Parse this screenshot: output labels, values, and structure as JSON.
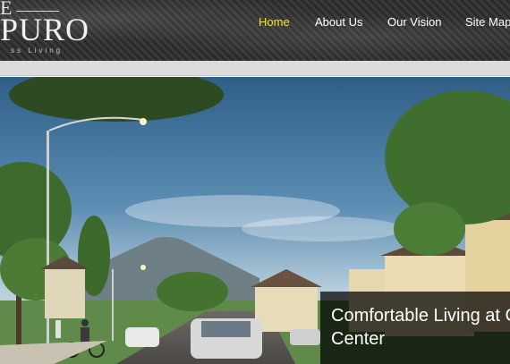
{
  "logo": {
    "top_letter": "E",
    "brand": "PURO",
    "tagline": "ss Living"
  },
  "nav": {
    "items": [
      {
        "label": "Home",
        "active": true
      },
      {
        "label": "About Us",
        "active": false
      },
      {
        "label": "Our Vision",
        "active": false
      },
      {
        "label": "Site Map",
        "active": false
      }
    ]
  },
  "hero": {
    "caption_line1": "Comfortable Living at C",
    "caption_line2": "Center"
  },
  "colors": {
    "nav_active": "#f6e23a",
    "nav_text": "#ffffff",
    "header_bg": "#2e2e2e",
    "caption_bg": "#000000"
  }
}
